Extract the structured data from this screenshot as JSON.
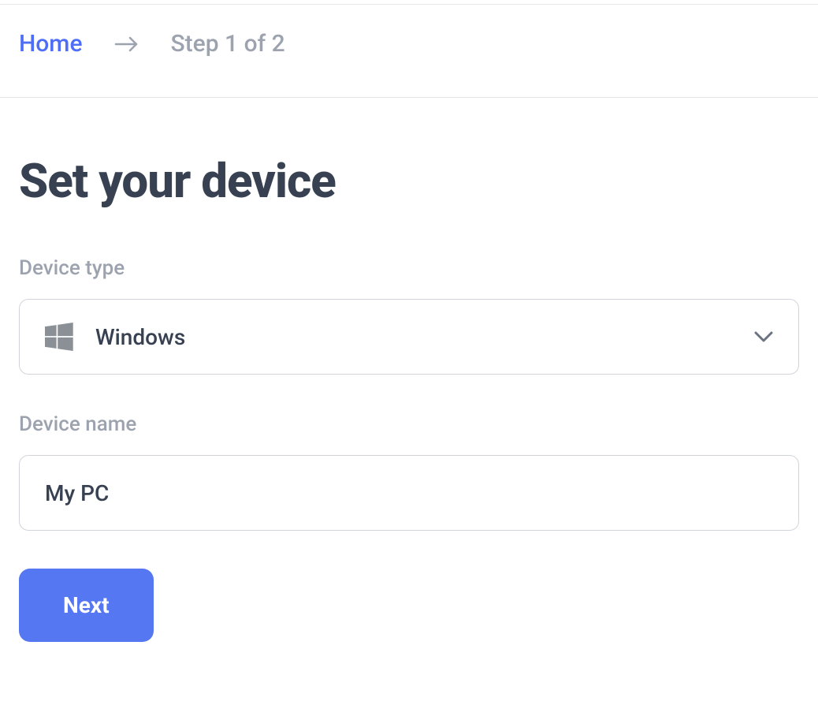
{
  "breadcrumb": {
    "home": "Home",
    "step": "Step 1 of 2"
  },
  "page": {
    "title": "Set your device"
  },
  "fields": {
    "device_type": {
      "label": "Device type",
      "value": "Windows",
      "icon": "windows-icon"
    },
    "device_name": {
      "label": "Device name",
      "value": "My PC"
    }
  },
  "buttons": {
    "next": "Next"
  }
}
